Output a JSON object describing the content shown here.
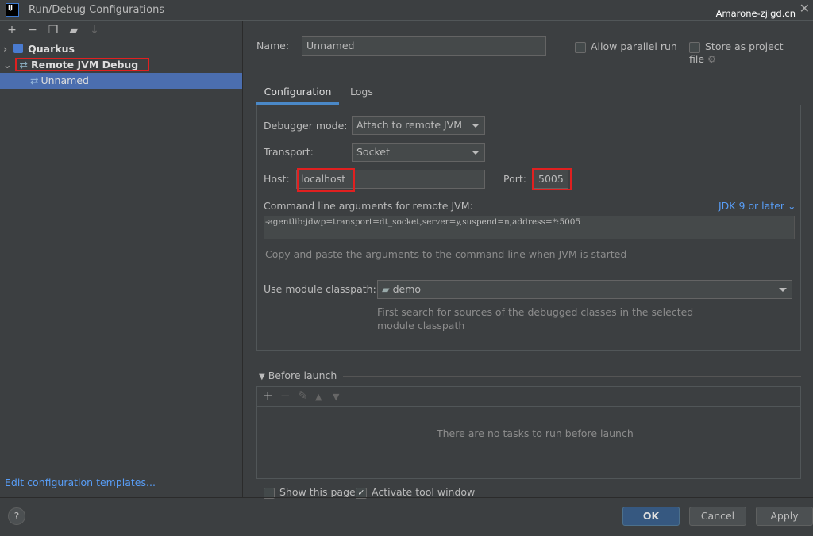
{
  "window": {
    "title": "Run/Debug Configurations",
    "watermark": "Amarone-zjlgd.cn",
    "logo": "IJ"
  },
  "toolbar": {
    "icons": [
      "plus-icon",
      "minus-icon",
      "copy-icon",
      "folder-add-icon",
      "sort-icon"
    ]
  },
  "tree": [
    {
      "label": "Quarkus"
    },
    {
      "label": "Remote JVM Debug"
    },
    {
      "label": "Unnamed"
    }
  ],
  "left_link": "Edit configuration templates...",
  "name": {
    "label": "Name:",
    "value": "Unnamed"
  },
  "allow_parallel": "Allow parallel run",
  "store_project": "Store as project file",
  "tabs": [
    "Configuration",
    "Logs"
  ],
  "debugger_mode": {
    "label": "Debugger mode:",
    "value": "Attach to remote JVM"
  },
  "transport": {
    "label": "Transport:",
    "value": "Socket"
  },
  "host": {
    "label": "Host:",
    "value": "localhost"
  },
  "port": {
    "label": "Port:",
    "value": "5005"
  },
  "cmdline": {
    "label": "Command line arguments for remote JVM:",
    "jdk": "JDK 9 or later",
    "value": "-agentlib:jdwp=transport=dt_socket,server=y,suspend=n,address=*:5005",
    "hint": "Copy and paste the arguments to the command line when JVM is started"
  },
  "module": {
    "label": "Use module classpath:",
    "value": "demo",
    "hint1": "First search for sources of the debugged classes in the selected",
    "hint2": "module classpath"
  },
  "before_launch": {
    "label": "Before launch",
    "empty": "There are no tasks to run before launch"
  },
  "show_page": "Show this page",
  "activate_tool": "Activate tool window",
  "buttons": {
    "ok": "OK",
    "cancel": "Cancel",
    "apply": "Apply",
    "help": "?"
  },
  "colors": {
    "accent": "#4b6eaf",
    "link": "#589df6",
    "highlight": "#e02020"
  }
}
